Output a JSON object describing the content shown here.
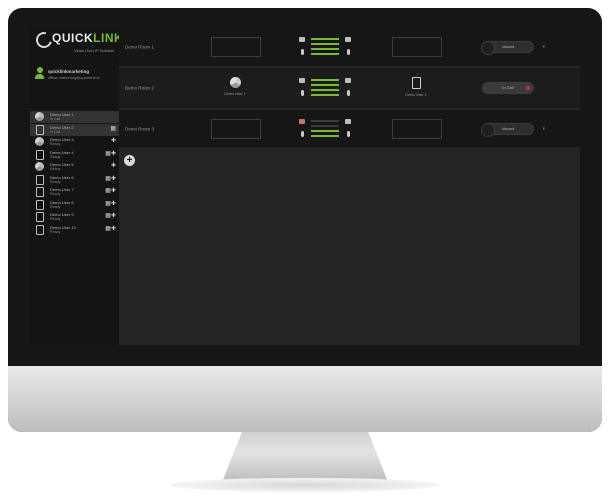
{
  "app": {
    "logo_text_main": "QUICK",
    "logo_text_accent": "LINK",
    "tagline": "Video Over IP Solution",
    "accent_color": "#7ab83a"
  },
  "user": {
    "name": "quicklinkmarketing",
    "email": "office.marketing@quicklink.tv"
  },
  "contacts": [
    {
      "name": "Demo User 1",
      "status": "In Call",
      "icon": "chrome-icon",
      "actions": ""
    },
    {
      "name": "Demo User 2",
      "status": "In Call",
      "icon": "phone-icon",
      "actions": "▦"
    },
    {
      "name": "Demo User 3",
      "status": "Ready",
      "icon": "chrome-icon",
      "actions": "✚"
    },
    {
      "name": "Demo User 4",
      "status": "Ready",
      "icon": "phone-icon",
      "actions": "▦✚"
    },
    {
      "name": "Demo User 5",
      "status": "Ready",
      "icon": "chrome-icon",
      "actions": "✚"
    },
    {
      "name": "Demo User 6",
      "status": "Ready",
      "icon": "phone-icon",
      "actions": "▦✚"
    },
    {
      "name": "Demo User 7",
      "status": "Ready",
      "icon": "phone-icon",
      "actions": "▦✚"
    },
    {
      "name": "Demo User 8",
      "status": "Ready",
      "icon": "phone-icon",
      "actions": "▦✚"
    },
    {
      "name": "Demo User 9",
      "status": "Ready",
      "icon": "phone-icon",
      "actions": "▦✚"
    },
    {
      "name": "Demo User 10",
      "status": "Ready",
      "icon": "phone-icon",
      "actions": "▦✚"
    }
  ],
  "rooms": [
    {
      "name": "Demo Room 1",
      "status": "Vacant"
    },
    {
      "name": "Demo Room 2",
      "status": "In Call",
      "device_a": "Demo User 1",
      "device_b": "Demo User 2"
    },
    {
      "name": "Demo Room 3",
      "status": "Vacant"
    }
  ],
  "add_button": "+"
}
